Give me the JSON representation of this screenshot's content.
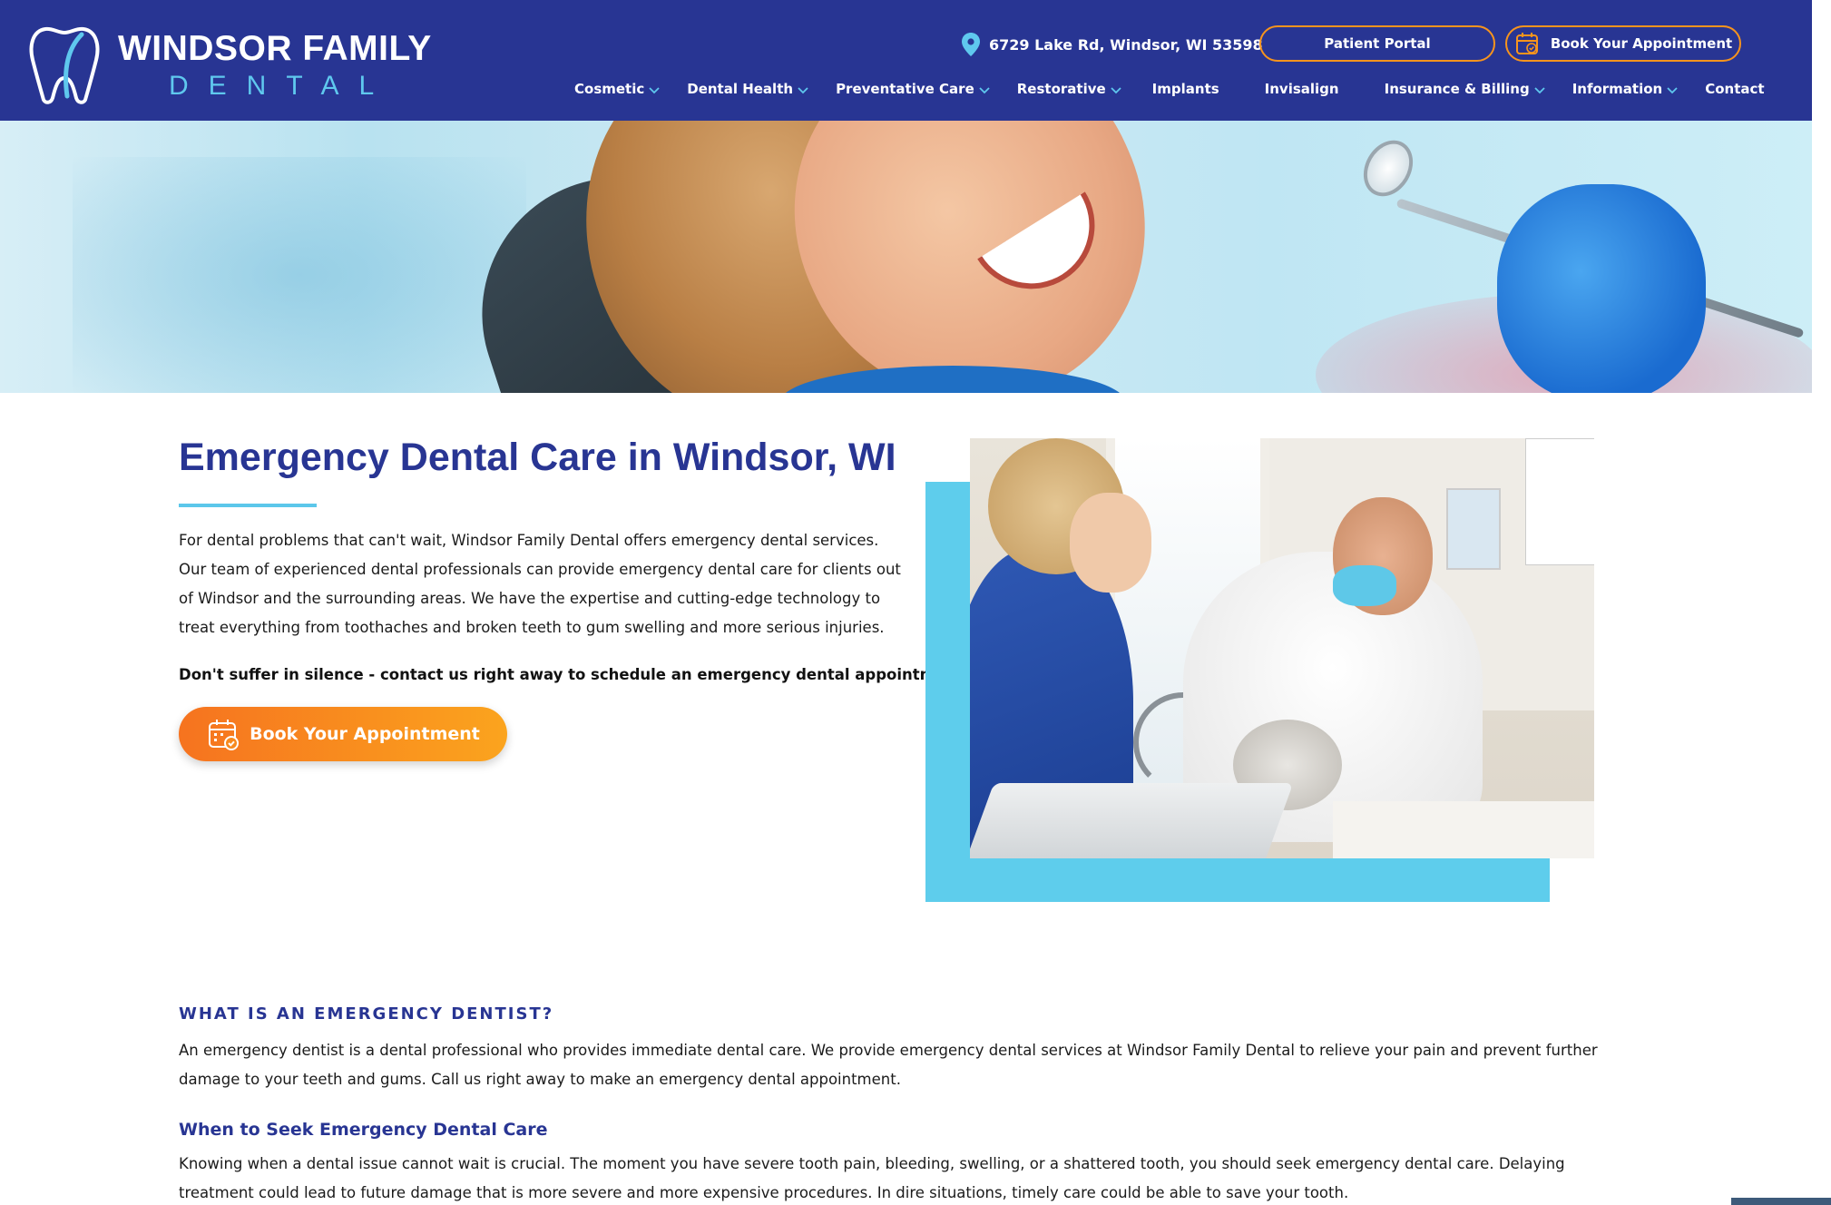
{
  "header": {
    "logo": {
      "line1": "WINDSOR FAMILY",
      "line2": "DENTAL"
    },
    "address": "6729 Lake Rd, Windsor, WI 53598",
    "portal_label": "Patient Portal",
    "book_label": "Book Your Appointment",
    "nav": [
      {
        "label": "Cosmetic",
        "dropdown": true
      },
      {
        "label": "Dental Health",
        "dropdown": true
      },
      {
        "label": "Preventative Care",
        "dropdown": true
      },
      {
        "label": "Restorative",
        "dropdown": true
      },
      {
        "label": "Implants",
        "dropdown": false
      },
      {
        "label": "Invisalign",
        "dropdown": false
      },
      {
        "label": "Insurance & Billing",
        "dropdown": true
      },
      {
        "label": "Information",
        "dropdown": true
      },
      {
        "label": "Contact",
        "dropdown": false
      }
    ]
  },
  "main": {
    "title": "Emergency Dental Care in Windsor, WI",
    "intro": "For dental problems that can't wait, Windsor Family Dental offers emergency dental services. Our team of experienced dental professionals can provide emergency dental care for clients out of Windsor and the surrounding areas. We have the expertise and cutting-edge technology to treat everything from toothaches and broken teeth to gum swelling and more serious injuries.",
    "callout": "Don't suffer in silence - contact us right away to schedule an emergency dental appointment.",
    "book_button": "Book Your Appointment"
  },
  "sections": {
    "what_heading": "WHAT IS AN EMERGENCY DENTIST?",
    "what_text": "An emergency dentist is a dental professional who provides immediate dental care. We provide emergency dental services at Windsor Family Dental to relieve your pain and prevent further damage to your teeth and gums. Call us right away to make an emergency dental appointment.",
    "when_heading": "When to Seek Emergency Dental Care",
    "when_text": "Knowing when a dental issue cannot wait is crucial. The moment you have severe tooth pain, bleeding, swelling, or a shattered tooth, you should seek emergency dental care. Delaying treatment could lead to future damage that is more severe and more expensive procedures. In dire situations, timely care could be able to save your tooth."
  },
  "colors": {
    "brand_navy": "#283593",
    "accent_cyan": "#5ecdec",
    "accent_orange": "#f7941d"
  },
  "icons": {
    "location": "map-pin-icon",
    "calendar": "calendar-check-icon",
    "chevron": "chevron-down-icon",
    "logo": "tooth-logo-icon"
  }
}
